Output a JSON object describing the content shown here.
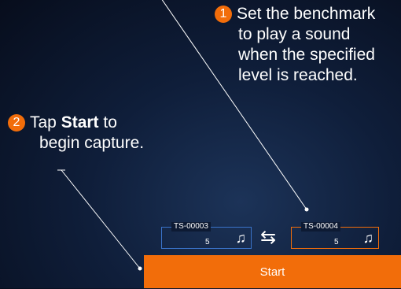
{
  "callouts": {
    "step1": {
      "number": "1",
      "lines": [
        "Set the benchmark",
        "to play a sound",
        "when the specified",
        "level is reached."
      ]
    },
    "step2": {
      "number": "2",
      "line1_prefix": "Tap ",
      "line1_bold": "Start",
      "line1_suffix": " to",
      "line2": "begin capture."
    }
  },
  "benchmarks": [
    {
      "id": "TS-00003",
      "level": "5",
      "accent": "#3a73c9",
      "icon": "music-note-icon"
    },
    {
      "id": "TS-00004",
      "level": "5",
      "accent": "#f26d0a",
      "icon": "music-note-icon"
    }
  ],
  "swap": {
    "icon": "swap-arrows-icon",
    "glyph": "⇆"
  },
  "start_button": {
    "label": "Start",
    "color": "#f26d0a"
  },
  "badge_color": "#f26d0a"
}
